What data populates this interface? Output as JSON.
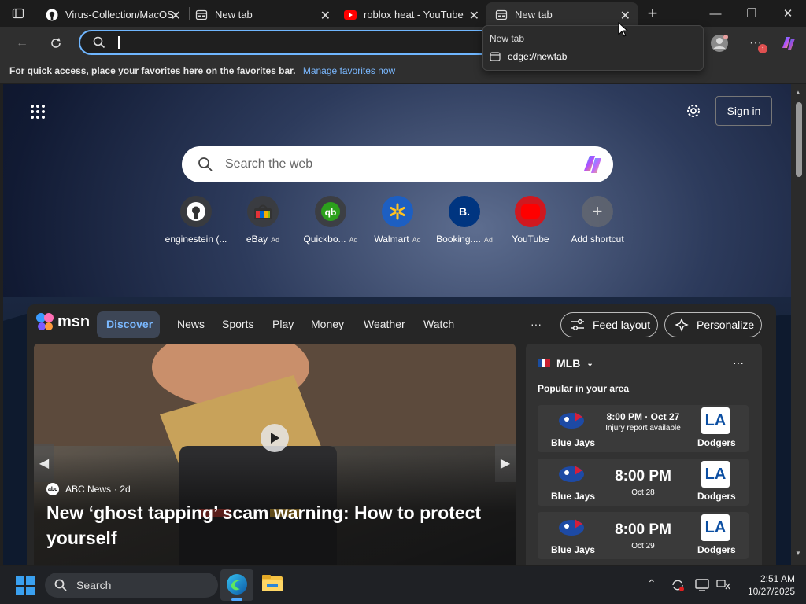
{
  "tabs": [
    {
      "label": "Virus-Collection/MacOS",
      "icon": "github-icon"
    },
    {
      "label": "New tab",
      "icon": "newtab-icon"
    },
    {
      "label": "roblox heat - YouTube",
      "icon": "youtube-icon"
    },
    {
      "label": "New tab",
      "icon": "newtab-icon",
      "active": true
    }
  ],
  "dropdown": {
    "title": "New tab",
    "url": "edge://newtab"
  },
  "favbar": {
    "text": "For quick access, place your favorites here on the favorites bar.",
    "link": "Manage favorites now"
  },
  "header": {
    "signin": "Sign in"
  },
  "search": {
    "placeholder": "Search the web"
  },
  "shortcuts": [
    {
      "label": "enginestein (...",
      "ad": ""
    },
    {
      "label": "eBay",
      "ad": "Ad"
    },
    {
      "label": "Quickbo...",
      "ad": "Ad"
    },
    {
      "label": "Walmart",
      "ad": "Ad"
    },
    {
      "label": "Booking....",
      "ad": "Ad"
    },
    {
      "label": "YouTube",
      "ad": ""
    },
    {
      "label": "Add shortcut",
      "ad": ""
    }
  ],
  "feed": {
    "logo": "msn",
    "nav": [
      "Discover",
      "News",
      "Sports",
      "Play",
      "Money",
      "Weather",
      "Watch"
    ],
    "more": "···",
    "feed_layout": "Feed layout",
    "personalize": "Personalize"
  },
  "hero": {
    "source": "ABC News",
    "age": "· 2d",
    "headline": "New ‘ghost tapping’ scam warning: How to protect yourself"
  },
  "mlb": {
    "league": "MLB",
    "subtitle": "Popular in your area",
    "games": [
      {
        "home": "Blue Jays",
        "away": "Dodgers",
        "time": "8:00 PM · Oct 27",
        "note": "Injury report available",
        "big": false
      },
      {
        "home": "Blue Jays",
        "away": "Dodgers",
        "time": "8:00 PM",
        "note": "Oct 28",
        "big": true
      },
      {
        "home": "Blue Jays",
        "away": "Dodgers",
        "time": "8:00 PM",
        "note": "Oct 29",
        "big": true
      }
    ]
  },
  "taskbar": {
    "search": "Search",
    "time": "2:51 AM",
    "date": "10/27/2025"
  },
  "colors": {
    "accent": "#6fb6ff",
    "link": "#7ab8ff",
    "active_tab": "#2f2f2f"
  }
}
